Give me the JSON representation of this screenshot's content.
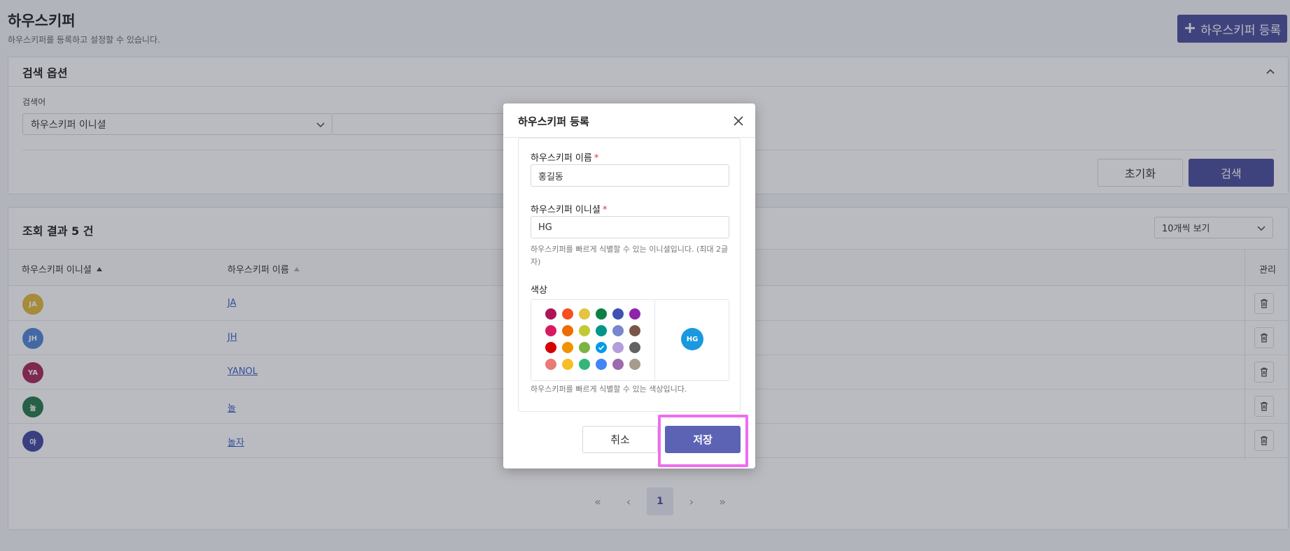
{
  "page": {
    "title": "하우스키퍼",
    "subtitle": "하우스키퍼를 등록하고 설정할 수 있습니다.",
    "register_label": "하우스키퍼 등록"
  },
  "search": {
    "header": "검색 옵션",
    "field_label": "검색어",
    "select_value": "하우스키퍼 이니셜",
    "reset_label": "초기화",
    "search_label": "검색"
  },
  "results": {
    "title": "조회 결과 5 건",
    "page_size": "10개씩 보기",
    "columns": {
      "initial": "하우스키퍼 이니셜",
      "name": "하우스키퍼 이름",
      "manage": "관리"
    },
    "rows": [
      {
        "initial": "JA",
        "name": "JA",
        "color": "#e0b93a"
      },
      {
        "initial": "JH",
        "name": "JH",
        "color": "#4f86d6"
      },
      {
        "initial": "YA",
        "name": "YANOL",
        "color": "#a8275a"
      },
      {
        "initial": "놀",
        "name": "놀",
        "color": "#257a4c"
      },
      {
        "initial": "야",
        "name": "놀자",
        "color": "#4149a3"
      }
    ],
    "pagination": {
      "first": "«",
      "prev": "‹",
      "current": "1",
      "next": "›",
      "last": "»"
    }
  },
  "modal": {
    "title": "하우스키퍼 등록",
    "name_label": "하우스키퍼 이름",
    "name_value": "홍길동",
    "initial_label": "하우스키퍼 이니셜",
    "initial_value": "HG",
    "initial_help": "하우스키퍼를 빠르게 식별할 수 있는 이니셜입니다. (최대 2글자)",
    "color_label": "색상",
    "color_help": "하우스키퍼를 빠르게 식별할 수 있는 색상입니다.",
    "required_mark": "*",
    "preview_initial": "HG",
    "preview_color": "#1a98e0",
    "selected_swatch_index": 15,
    "swatches": [
      "#ad1457",
      "#f4511e",
      "#e4c441",
      "#0b8043",
      "#3f51b5",
      "#8e24aa",
      "#d81b60",
      "#ef6c00",
      "#c0ca33",
      "#009688",
      "#7986cb",
      "#795548",
      "#d50000",
      "#f09300",
      "#7cb342",
      "#039be5",
      "#b39ddb",
      "#616161",
      "#e67c73",
      "#f6bf26",
      "#33b679",
      "#4285f4",
      "#9e69af",
      "#a79b8e"
    ],
    "cancel_label": "취소",
    "save_label": "저장"
  }
}
